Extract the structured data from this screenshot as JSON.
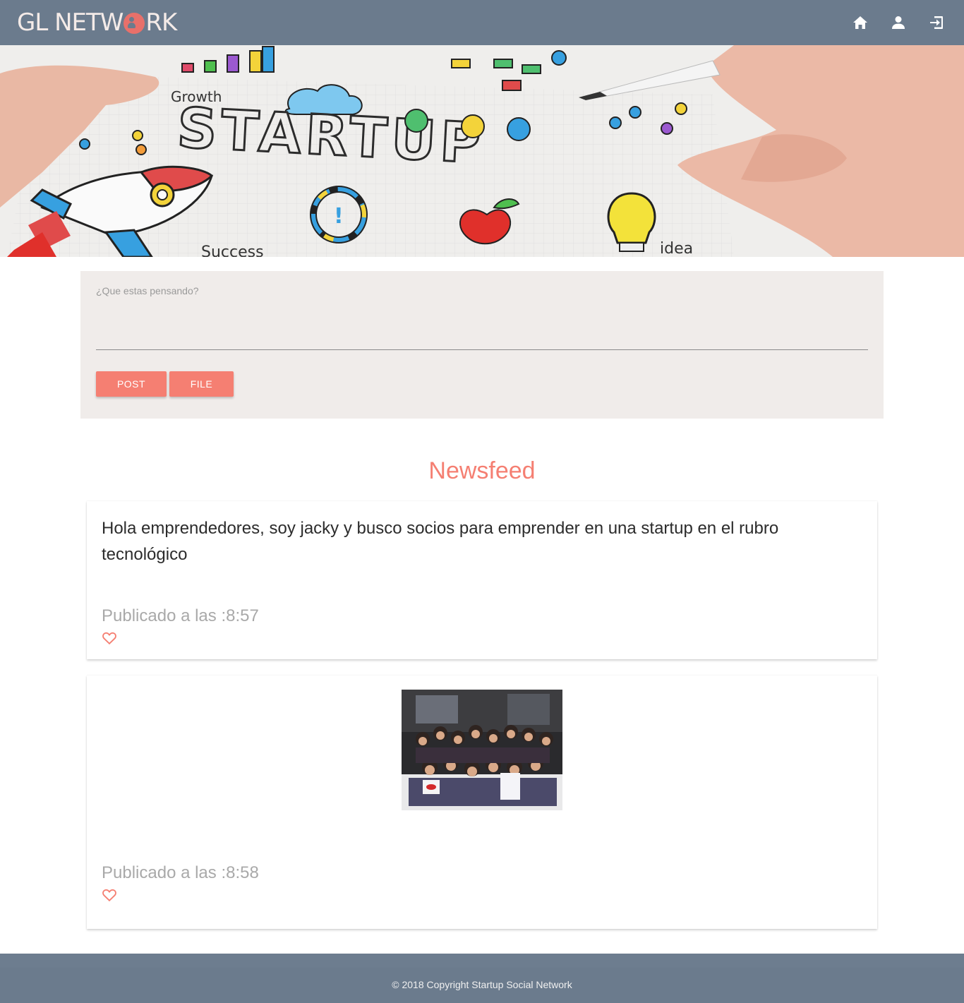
{
  "navbar": {
    "logo_prefix": "GL NETW",
    "logo_suffix": "RK",
    "icons": [
      "home-icon",
      "person-icon",
      "logout-icon"
    ]
  },
  "hero": {
    "image": "startup-doodle-banner",
    "words": {
      "main": "STARTUP",
      "growth": "Growth",
      "success": "Success",
      "idea": "idea"
    }
  },
  "composer": {
    "placeholder": "¿Que estas pensando?",
    "post_label": "POST",
    "file_label": "FILE"
  },
  "feed": {
    "title": "Newsfeed",
    "posts": [
      {
        "text": "Hola emprendedores, soy jacky y busco socios para emprender en una startup en el rubro tecnológico",
        "time": "Publicado a las :8:57"
      },
      {
        "image": "group-photo",
        "time": "Publicado a las :8:58"
      }
    ]
  },
  "footer": {
    "copyright": "© 2018 Copyright Startup Social Network"
  },
  "colors": {
    "navbar": "#6b7b8d",
    "accent": "#f57f72",
    "composer_bg": "#f0ecea"
  }
}
